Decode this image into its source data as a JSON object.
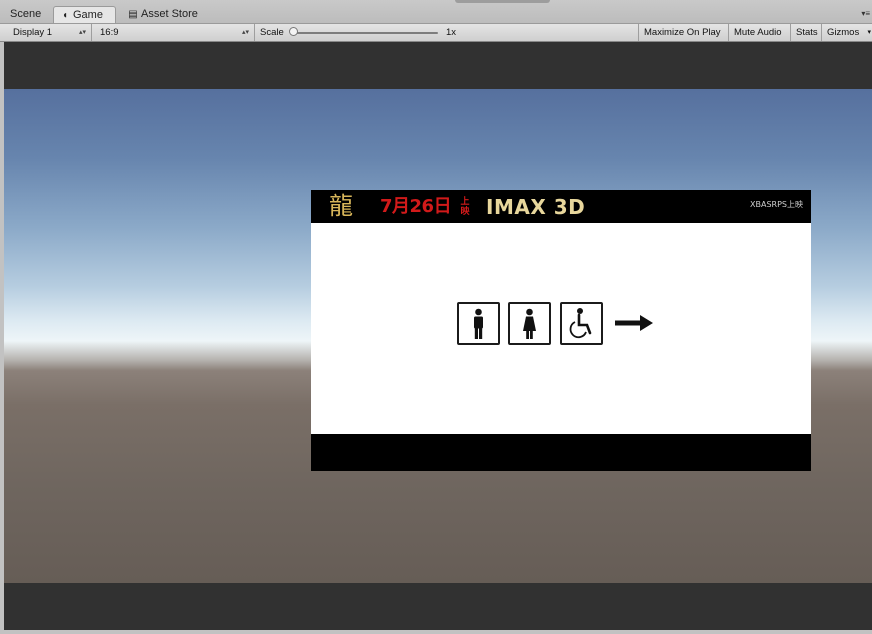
{
  "tabs": [
    {
      "label": "Scene",
      "icon": ""
    },
    {
      "label": "Game",
      "icon": "game-pacman-icon"
    },
    {
      "label": "Asset Store",
      "icon": "store-bag-icon"
    }
  ],
  "toolbar": {
    "display": "Display 1",
    "aspect": "16:9",
    "scale_label": "Scale",
    "scale_value": "1x",
    "scale_level": 0,
    "buttons": {
      "maximize": "Maximize On Play",
      "mute": "Mute Audio",
      "stats": "Stats",
      "gizmos": "Gizmos"
    }
  },
  "game_view": {
    "ad": {
      "release_date": "7月26日",
      "release_suffix": "上映",
      "format": "IMAX 3D",
      "small_text": "XBASRPS上映",
      "signs": [
        "men-restroom-icon",
        "women-restroom-icon",
        "wheelchair-accessible-icon",
        "right-arrow-icon"
      ],
      "colors": {
        "date": "#d21a1a",
        "format": "#e8d79c",
        "logo": "#d8b65a"
      }
    }
  }
}
